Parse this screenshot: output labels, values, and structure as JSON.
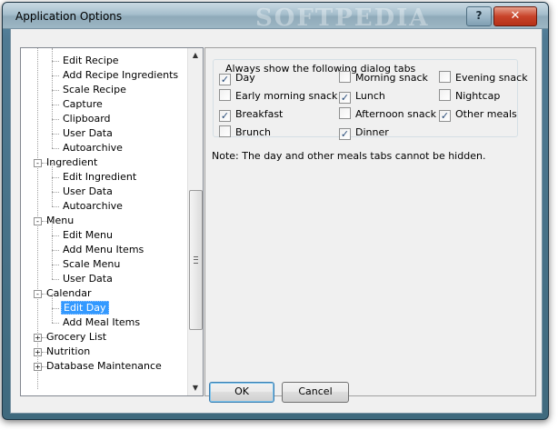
{
  "window": {
    "title": "Application Options",
    "watermark": "SOFTPEDIA",
    "help_label": "?",
    "close_label": "✕"
  },
  "tree": {
    "items": [
      {
        "label": "Edit Recipe",
        "level": 2
      },
      {
        "label": "Add Recipe Ingredients",
        "level": 2
      },
      {
        "label": "Scale Recipe",
        "level": 2
      },
      {
        "label": "Capture",
        "level": 2
      },
      {
        "label": "Clipboard",
        "level": 2
      },
      {
        "label": "User Data",
        "level": 2
      },
      {
        "label": "Autoarchive",
        "level": 2
      },
      {
        "label": "Ingredient",
        "level": 1,
        "expander": "−"
      },
      {
        "label": "Edit Ingredient",
        "level": 2
      },
      {
        "label": "User Data",
        "level": 2
      },
      {
        "label": "Autoarchive",
        "level": 2
      },
      {
        "label": "Menu",
        "level": 1,
        "expander": "−"
      },
      {
        "label": "Edit Menu",
        "level": 2
      },
      {
        "label": "Add Menu Items",
        "level": 2
      },
      {
        "label": "Scale Menu",
        "level": 2
      },
      {
        "label": "User Data",
        "level": 2
      },
      {
        "label": "Calendar",
        "level": 1,
        "expander": "−"
      },
      {
        "label": "Edit Day",
        "level": 2,
        "selected": true
      },
      {
        "label": "Add Meal Items",
        "level": 2
      },
      {
        "label": "Grocery List",
        "level": 1,
        "expander": "+"
      },
      {
        "label": "Nutrition",
        "level": 1,
        "expander": "+"
      },
      {
        "label": "Database Maintenance",
        "level": 1,
        "expander": "+"
      }
    ]
  },
  "panel": {
    "group_label": "Always show the following dialog tabs",
    "checkboxes": [
      {
        "label": "Day",
        "checked": true
      },
      {
        "label": "Morning snack",
        "checked": false
      },
      {
        "label": "Evening snack",
        "checked": false
      },
      {
        "label": "Early morning snack",
        "checked": false
      },
      {
        "label": "Lunch",
        "checked": true
      },
      {
        "label": "Nightcap",
        "checked": false
      },
      {
        "label": "Breakfast",
        "checked": true
      },
      {
        "label": "Afternoon snack",
        "checked": false
      },
      {
        "label": "Other meals",
        "checked": true
      },
      {
        "label": "Brunch",
        "checked": false
      },
      {
        "label": "Dinner",
        "checked": true
      }
    ],
    "note": "Note: The day and other meals tabs cannot be hidden."
  },
  "buttons": {
    "ok": "OK",
    "cancel": "Cancel"
  },
  "colors": {
    "selection": "#3399ff",
    "title_bar": "#a6bfcd",
    "close_button": "#c8432a"
  }
}
